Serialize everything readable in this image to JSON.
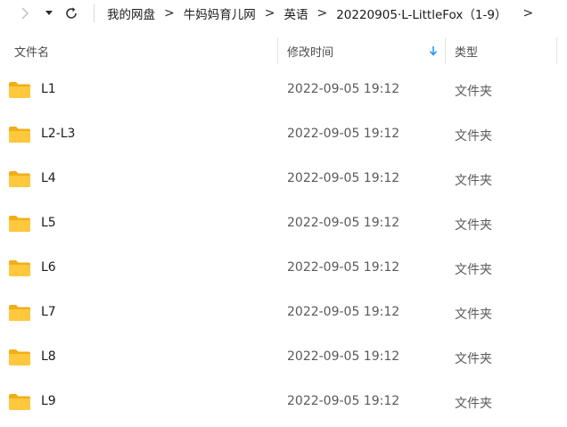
{
  "breadcrumb": [
    {
      "label": "我的网盘"
    },
    {
      "label": "牛妈妈育儿网"
    },
    {
      "label": "英语"
    },
    {
      "label": "20220905·L-LittleFox（1-9）"
    }
  ],
  "icons": {
    "forward": "chevron-right-icon",
    "history": "chevron-down-icon",
    "refresh": "refresh-icon",
    "folder": "folder-icon",
    "sort": "sort-down-arrow-icon"
  },
  "colors": {
    "folder": "#FFC83D",
    "folder_tab": "#F1AE17",
    "sort_arrow": "#1E90FF"
  },
  "columns": {
    "name": "文件名",
    "date": "修改时间",
    "type": "类型"
  },
  "files": [
    {
      "name": "L1",
      "date": "2022-09-05 19:12",
      "type": "文件夹"
    },
    {
      "name": "L2-L3",
      "date": "2022-09-05 19:12",
      "type": "文件夹"
    },
    {
      "name": "L4",
      "date": "2022-09-05 19:12",
      "type": "文件夹"
    },
    {
      "name": "L5",
      "date": "2022-09-05 19:12",
      "type": "文件夹"
    },
    {
      "name": "L6",
      "date": "2022-09-05 19:12",
      "type": "文件夹"
    },
    {
      "name": "L7",
      "date": "2022-09-05 19:12",
      "type": "文件夹"
    },
    {
      "name": "L8",
      "date": "2022-09-05 19:12",
      "type": "文件夹"
    },
    {
      "name": "L9",
      "date": "2022-09-05 19:12",
      "type": "文件夹"
    }
  ]
}
